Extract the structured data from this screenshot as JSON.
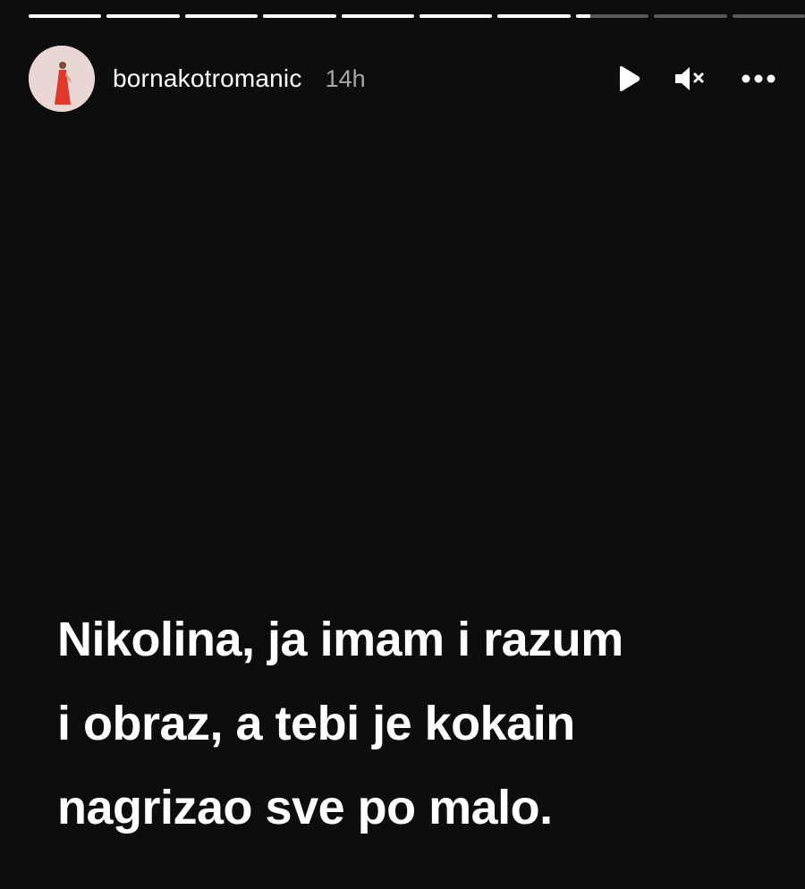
{
  "progress": {
    "segments": [
      1,
      1,
      1,
      1,
      1,
      1,
      1,
      0.2,
      0,
      0
    ]
  },
  "header": {
    "username": "bornakotromanic",
    "time": "14h",
    "icons": {
      "avatar": "profile-photo-woman-red-dress",
      "play": "play-icon",
      "mute": "speaker-muted-icon",
      "more": "more-options-icon"
    }
  },
  "story": {
    "lines": [
      "Nikolina, ja imam i razum",
      "i obraz, a tebi je kokain",
      "nagrizao sve po malo."
    ]
  },
  "colors": {
    "background": "#0d0d0d",
    "text": "#ffffff",
    "muted_text": "#a8a8a8",
    "progress_track": "#525252",
    "avatar_bg": "#ead6d2",
    "avatar_dress": "#e0382b"
  }
}
